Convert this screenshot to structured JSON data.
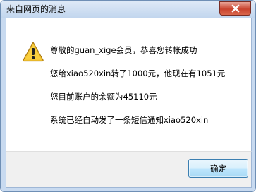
{
  "dialog": {
    "title": "来自网页的消息",
    "icon": "warning-icon",
    "messages": [
      "尊敬的guan_xige会员，恭喜您转帐成功",
      "您给xiao520xin转了1000元，他现在有1051元",
      "您目前账户的余额为45110元",
      "系统已经自动发了一条短信通知xiao520xin"
    ],
    "ok_label": "确定"
  },
  "colors": {
    "close_button": "#c9442f",
    "warning_fill": "#f2c230",
    "ok_button_border": "#3c7fb1"
  }
}
